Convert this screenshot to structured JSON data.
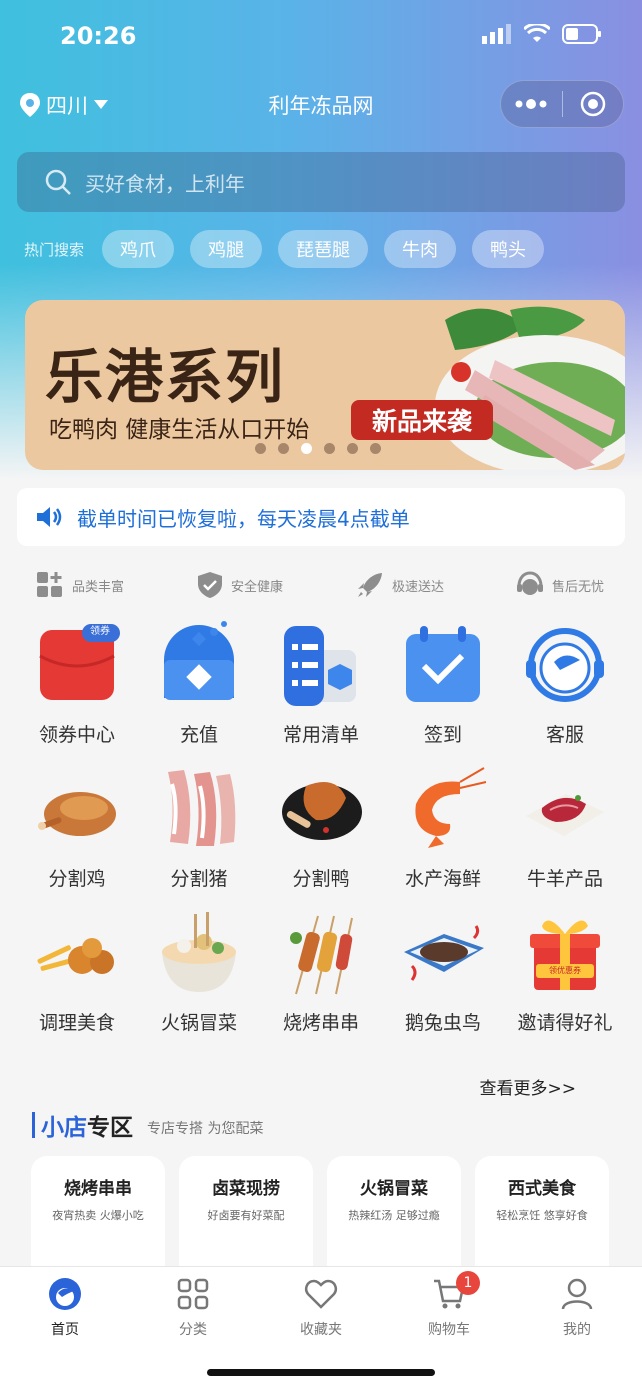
{
  "status_bar": {
    "time": "20:26"
  },
  "nav": {
    "location": "四川",
    "title": "利年冻品网"
  },
  "search": {
    "placeholder": "买好食材，上利年"
  },
  "hot_search": {
    "label": "热门搜索",
    "tags": [
      "鸡爪",
      "鸡腿",
      "琵琶腿",
      "牛肉",
      "鸭头"
    ]
  },
  "banner": {
    "title": "乐港系列",
    "subtitle": "吃鸭肉 健康生活从口开始",
    "badge": "新品来袭",
    "slides": 6,
    "active_slide": 3
  },
  "notice": {
    "text": "截单时间已恢复啦，每天凌晨4点截单"
  },
  "features": [
    "品类丰富",
    "安全健康",
    "极速送达",
    "售后无忧"
  ],
  "grid": {
    "items": [
      {
        "label": "领券中心",
        "icon": "coupon-icon",
        "tag": "领券"
      },
      {
        "label": "充值",
        "icon": "recharge-icon"
      },
      {
        "label": "常用清单",
        "icon": "list-icon"
      },
      {
        "label": "签到",
        "icon": "checkin-icon"
      },
      {
        "label": "客服",
        "icon": "customer-service-icon"
      },
      {
        "label": "分割鸡",
        "icon": "chicken-icon"
      },
      {
        "label": "分割猪",
        "icon": "pork-icon"
      },
      {
        "label": "分割鸭",
        "icon": "duck-icon"
      },
      {
        "label": "水产海鲜",
        "icon": "shrimp-icon"
      },
      {
        "label": "牛羊产品",
        "icon": "beef-icon"
      },
      {
        "label": "调理美食",
        "icon": "prepared-food-icon"
      },
      {
        "label": "火锅冒菜",
        "icon": "hotpot-icon"
      },
      {
        "label": "烧烤串串",
        "icon": "skewer-icon"
      },
      {
        "label": "鹅兔虫鸟",
        "icon": "poultry-icon"
      },
      {
        "label": "邀请得好礼",
        "icon": "gift-icon",
        "tag": "领优惠券"
      }
    ]
  },
  "more_label": "查看更多>>",
  "shop_zone": {
    "title_blue": "小店",
    "title_black": "专区",
    "desc": "专店专搭 为您配菜"
  },
  "shop_cards": [
    {
      "title": "烧烤串串",
      "sub": "夜宵热卖 火爆小吃"
    },
    {
      "title": "卤菜现捞",
      "sub": "好卤要有好菜配"
    },
    {
      "title": "火锅冒菜",
      "sub": "热辣红汤 足够过瘾"
    },
    {
      "title": "西式美食",
      "sub": "轻松烹饪 悠享好食"
    }
  ],
  "tabbar": {
    "items": [
      {
        "label": "首页",
        "icon": "home-icon"
      },
      {
        "label": "分类",
        "icon": "category-icon"
      },
      {
        "label": "收藏夹",
        "icon": "heart-icon"
      },
      {
        "label": "购物车",
        "icon": "cart-icon",
        "badge": "1"
      },
      {
        "label": "我的",
        "icon": "user-icon"
      }
    ]
  },
  "colors": {
    "accent": "#2b63d8",
    "notice": "#1f6fd9",
    "badge": "#e8453c",
    "banner_bg": "#ecc8a1"
  }
}
